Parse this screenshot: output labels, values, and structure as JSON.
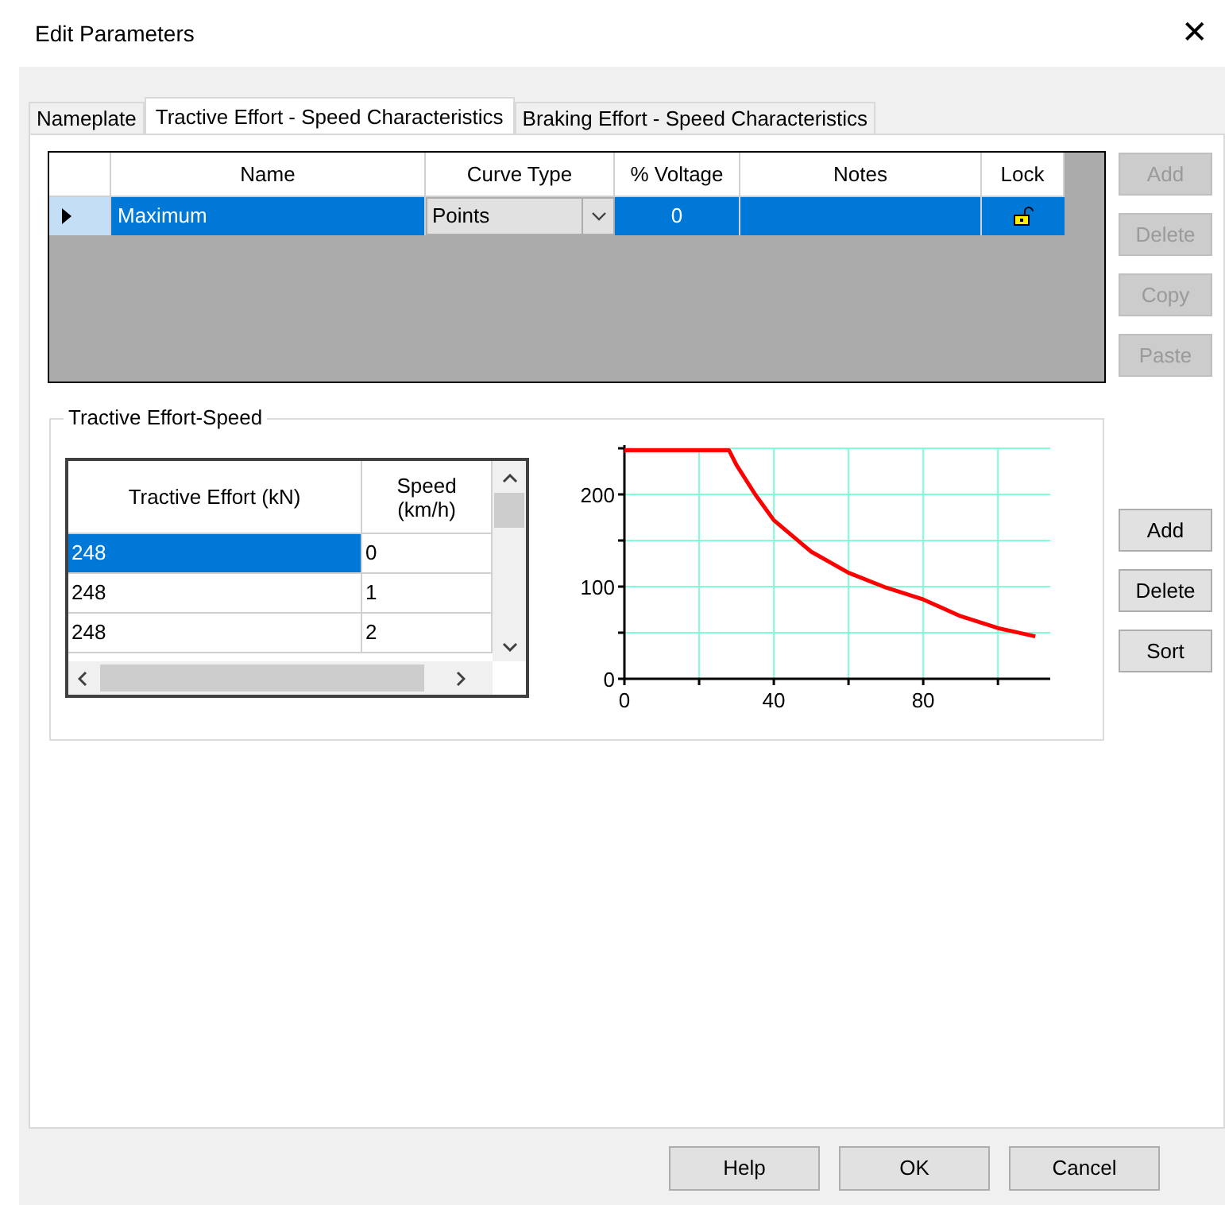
{
  "window": {
    "title": "Edit Parameters",
    "close": "✕"
  },
  "tabs": [
    {
      "label": "Nameplate",
      "selected": false
    },
    {
      "label": "Tractive Effort - Speed Characteristics",
      "selected": true
    },
    {
      "label": "Braking Effort - Speed Characteristics",
      "selected": false
    }
  ],
  "curves_table": {
    "columns": [
      "Name",
      "Curve Type",
      "% Voltage",
      "Notes",
      "Lock"
    ],
    "rows": [
      {
        "name": "Maximum",
        "curve_type": "Points",
        "voltage": "0",
        "notes": "",
        "locked": false,
        "selected": true
      }
    ]
  },
  "curve_buttons": [
    {
      "label": "Add",
      "disabled": true
    },
    {
      "label": "Delete",
      "disabled": true
    },
    {
      "label": "Copy",
      "disabled": true
    },
    {
      "label": "Paste",
      "disabled": true
    }
  ],
  "group": {
    "title": "Tractive Effort-Speed",
    "points_table": {
      "columns": [
        "Tractive Effort (kN)",
        "Speed (km/h)"
      ],
      "rows": [
        {
          "effort": "248",
          "speed": "0",
          "selected": true
        },
        {
          "effort": "248",
          "speed": "1",
          "selected": false
        },
        {
          "effort": "248",
          "speed": "2",
          "selected": false
        }
      ]
    },
    "chart_data": {
      "type": "line",
      "x": [
        0,
        28,
        30,
        35,
        40,
        50,
        60,
        70,
        80,
        90,
        100,
        110
      ],
      "series": [
        {
          "color": "#ff0000",
          "values": [
            248,
            248,
            232,
            200,
            172,
            138,
            115,
            99,
            86,
            68,
            55,
            46
          ]
        }
      ],
      "xlim": [
        0,
        114
      ],
      "ylim": [
        0,
        250
      ],
      "xticks": [
        0,
        40,
        80
      ],
      "yticks": [
        0,
        100,
        200
      ],
      "grid": true
    },
    "point_buttons": [
      {
        "label": "Add",
        "disabled": false
      },
      {
        "label": "Delete",
        "disabled": false
      },
      {
        "label": "Sort",
        "disabled": false
      }
    ]
  },
  "footer_buttons": [
    {
      "label": "Help"
    },
    {
      "label": "OK"
    },
    {
      "label": "Cancel"
    }
  ]
}
